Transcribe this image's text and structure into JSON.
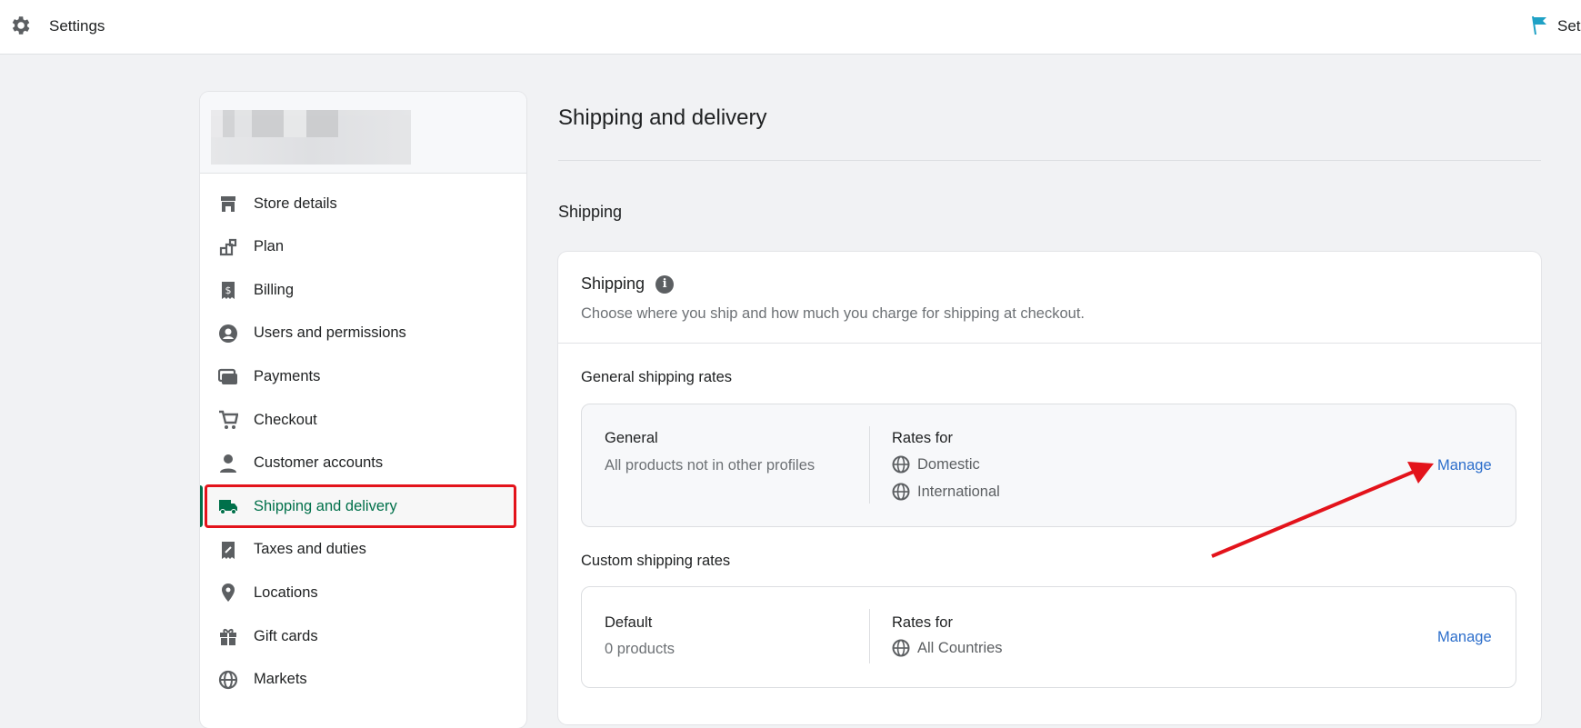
{
  "topbar": {
    "title": "Settings",
    "icon": "gear-icon",
    "right_label": "Set",
    "right_icon": "flag-icon",
    "flag_color": "#1fa1c5"
  },
  "sidebar": {
    "store_name": "",
    "items": [
      {
        "label": "Store details",
        "icon": "store-icon"
      },
      {
        "label": "Plan",
        "icon": "plan-icon"
      },
      {
        "label": "Billing",
        "icon": "billing-icon"
      },
      {
        "label": "Users and permissions",
        "icon": "user-circle-icon"
      },
      {
        "label": "Payments",
        "icon": "payments-icon"
      },
      {
        "label": "Checkout",
        "icon": "cart-icon"
      },
      {
        "label": "Customer accounts",
        "icon": "person-icon"
      },
      {
        "label": "Shipping and delivery",
        "icon": "truck-icon",
        "active": true
      },
      {
        "label": "Taxes and duties",
        "icon": "tax-icon"
      },
      {
        "label": "Locations",
        "icon": "location-pin-icon"
      },
      {
        "label": "Gift cards",
        "icon": "gift-icon"
      },
      {
        "label": "Markets",
        "icon": "globe-icon"
      }
    ]
  },
  "main": {
    "title": "Shipping and delivery",
    "section": "Shipping",
    "card": {
      "title": "Shipping",
      "description": "Choose where you ship and how much you charge for shipping at checkout.",
      "general_heading": "General shipping rates",
      "general": {
        "name": "General",
        "subtitle": "All products not in other profiles",
        "rates_label": "Rates for",
        "zones": [
          "Domestic",
          "International"
        ],
        "action": "Manage"
      },
      "custom_heading": "Custom shipping rates",
      "custom": {
        "name": "Default",
        "subtitle": "0 products",
        "rates_label": "Rates for",
        "zones": [
          "All Countries"
        ],
        "action": "Manage"
      }
    }
  },
  "colors": {
    "accent_green": "#00704a",
    "link": "#2c6ecb",
    "annotation": "#e3131b"
  }
}
